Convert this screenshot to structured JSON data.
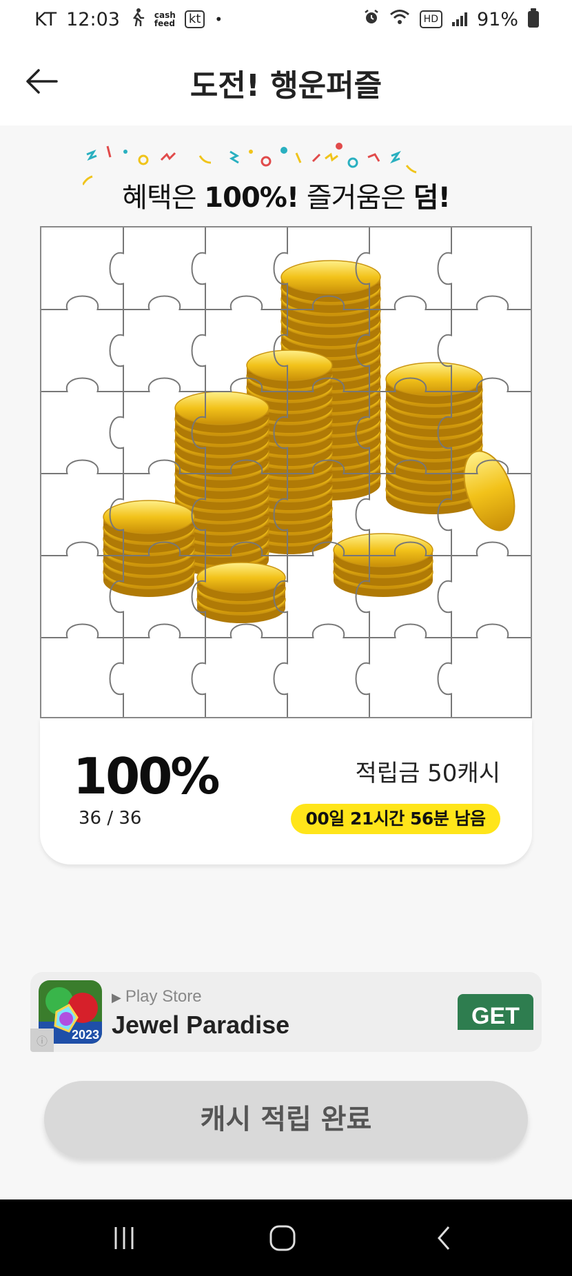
{
  "status_bar": {
    "carrier": "KT",
    "time": "12:03",
    "notif_cash_feed": "cash feed",
    "notif_kt": "kt",
    "dot": "•",
    "battery": "91%",
    "network": "HD"
  },
  "header": {
    "title": "도전! 행운퍼즐",
    "back_icon": "arrow-left-icon"
  },
  "banner": {
    "text_part1": "혜택은 ",
    "text_bold1": "100%!",
    "text_part2": " 즐거움은 ",
    "text_bold2": "덤!"
  },
  "puzzle": {
    "rows": 6,
    "cols": 6,
    "image": "gold coin stacks"
  },
  "result": {
    "percent": "100%",
    "count": "36 / 36",
    "reward": "적립금 50캐시",
    "timer": "00일 21시간 56분 남음"
  },
  "ad": {
    "source": "Play Store",
    "title": "Jewel Paradise",
    "icon_year": "2023",
    "cta": "GET"
  },
  "main_button": {
    "label": "캐시 적립 완료"
  },
  "colors": {
    "accent_yellow": "#ffe51a",
    "ad_get_green": "#2e7d4f",
    "button_gray": "#d9d9d9",
    "background": "#f7f7f7"
  }
}
